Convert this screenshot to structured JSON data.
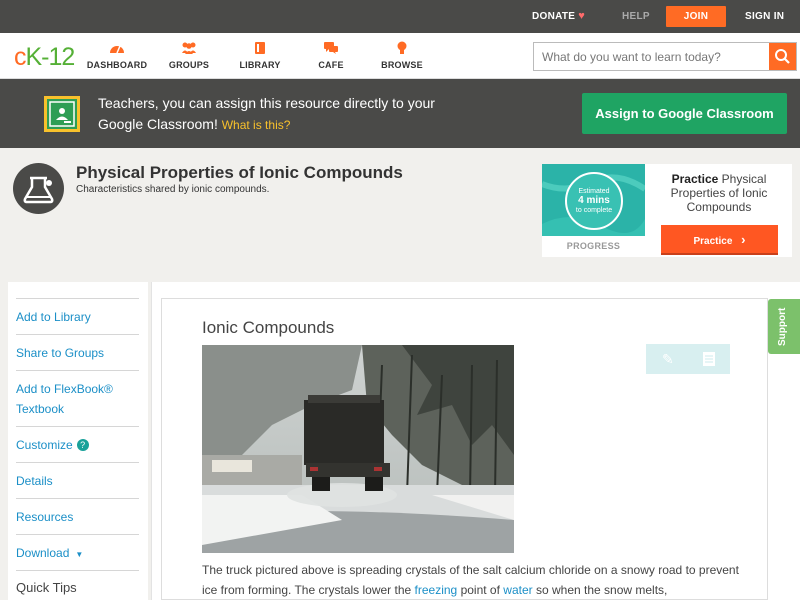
{
  "topbar": {
    "donate": "DONATE",
    "help": "HELP",
    "join": "JOIN",
    "sign_in": "SIGN IN"
  },
  "nav": {
    "logo_c": "c",
    "logo_rest": "K-12",
    "items": [
      {
        "label": "DASHBOARD",
        "icon": "dashboard-icon"
      },
      {
        "label": "GROUPS",
        "icon": "groups-icon"
      },
      {
        "label": "LIBRARY",
        "icon": "library-icon"
      },
      {
        "label": "CAFE",
        "icon": "cafe-icon"
      },
      {
        "label": "BROWSE",
        "icon": "browse-icon"
      }
    ],
    "search_placeholder": "What do you want to learn today?"
  },
  "banner": {
    "text": "Teachers, you can assign this resource directly to your Google Classroom!",
    "what": "What is this?",
    "button": "Assign to Google Classroom"
  },
  "lesson": {
    "title": "Physical Properties of Ionic Compounds",
    "subtitle": "Characteristics shared by ionic compounds."
  },
  "practice": {
    "estimated": "Estimated",
    "minutes": "4 mins",
    "to_complete": "to complete",
    "progress_label": "PROGRESS",
    "practice_bold": "Practice",
    "practice_rest": "Physical Properties of Ionic Compounds",
    "button": "Practice"
  },
  "sidebar": {
    "add_library": "Add to Library",
    "share_groups": "Share to Groups",
    "add_flexbook_1": "Add to FlexBook®",
    "add_flexbook_2": "Textbook",
    "customize": "Customize",
    "customize_help": "?",
    "details": "Details",
    "resources": "Resources",
    "download": "Download",
    "download_arrow": "▼",
    "quick_tips": "Quick Tips"
  },
  "content": {
    "section_title": "Ionic Compounds",
    "para_1": "The truck pictured above is spreading crystals of the salt calcium chloride on a snowy road to prevent ice from forming. The crystals lower the",
    "link_freezing": "freezing",
    "para_2": "point of",
    "link_water": "water",
    "para_3": "so when the snow melts,"
  },
  "support": "Support",
  "colors": {
    "accent": "#ff6b24",
    "classroom_green": "#1fa463",
    "link": "#1b8fc7",
    "teal": "#2bb3a8"
  }
}
